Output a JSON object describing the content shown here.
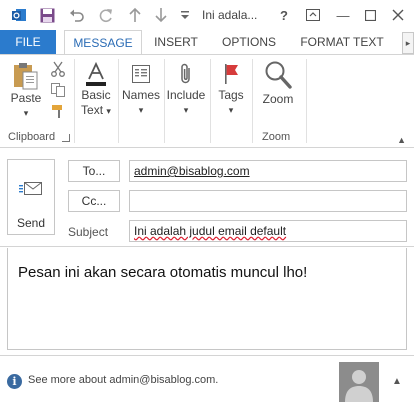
{
  "window": {
    "title": "Ini adala...",
    "help": "?",
    "minimize": "—"
  },
  "tabs": [
    "FILE",
    "MESSAGE",
    "INSERT",
    "OPTIONS",
    "FORMAT TEXT"
  ],
  "ribbon": {
    "paste": "Paste",
    "basic_text_1": "Basic",
    "basic_text_2": "Text",
    "names": "Names",
    "include": "Include",
    "tags": "Tags",
    "zoom": "Zoom",
    "group_clipboard": "Clipboard",
    "group_zoom": "Zoom",
    "dropdown_glyph": "▾"
  },
  "compose": {
    "send": "Send",
    "to_button": "To...",
    "cc_button": "Cc...",
    "subject_label": "Subject",
    "to_value": "admin@bisablog.com",
    "cc_value": "",
    "subject_value": "Ini adalah judul email default",
    "body": "Pesan ini akan secara otomatis muncul lho!"
  },
  "people_pane": {
    "text": "See more about admin@bisablog.com."
  },
  "colors": {
    "accent": "#2b7bcd",
    "tab_active_text": "#2b6cb5"
  }
}
